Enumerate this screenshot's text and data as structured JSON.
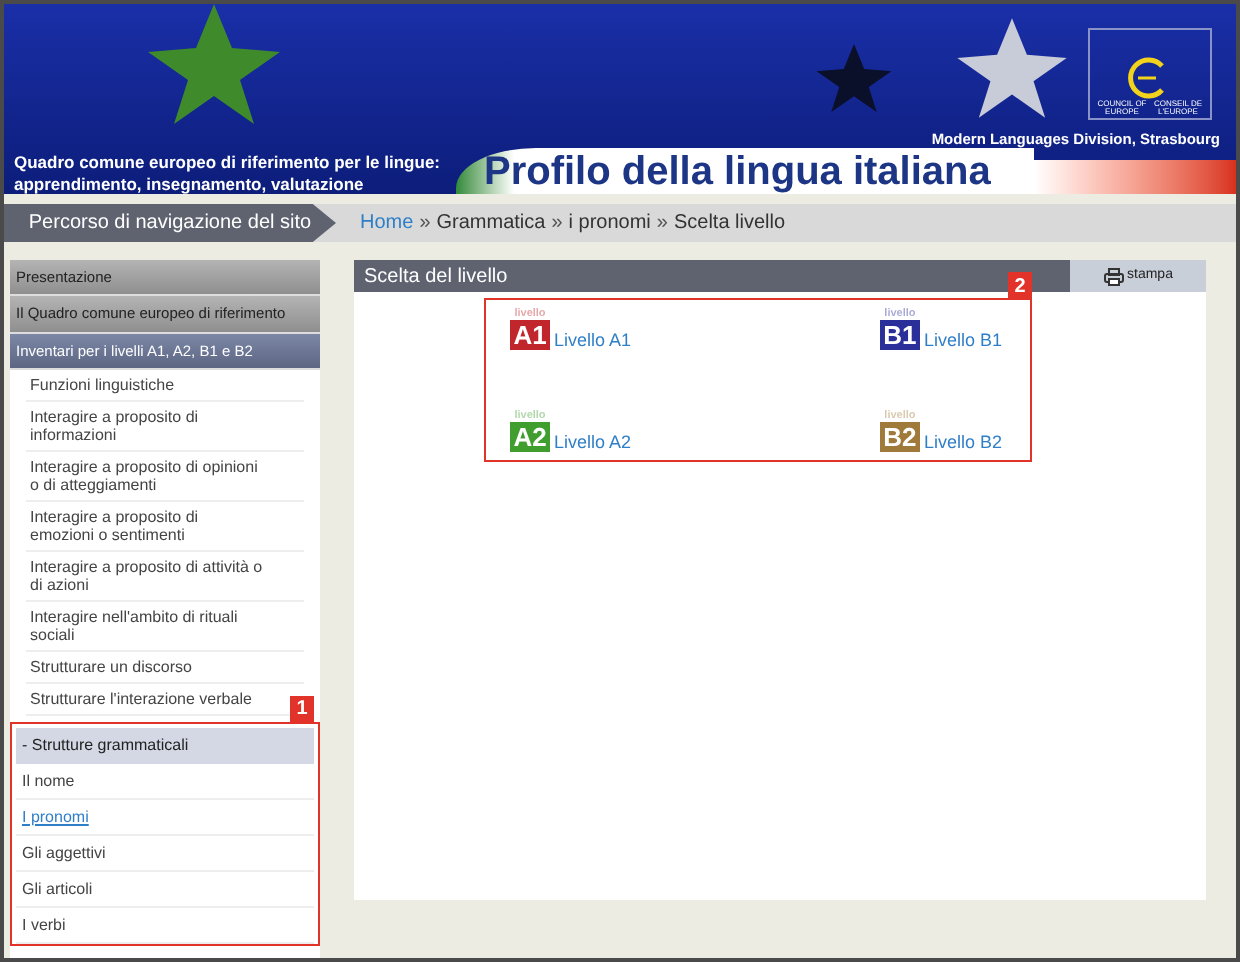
{
  "header": {
    "subtitle_lines": [
      "Quadro comune europeo di riferimento per le lingue:",
      "apprendimento, insegnamento, valutazione"
    ],
    "title": "Profilo della lingua italiana",
    "logo_texts": [
      "COUNCIL OF EUROPE",
      "CONSEIL DE L'EUROPE"
    ],
    "division": "Modern Languages Division, Strasbourg"
  },
  "nav_bar": {
    "label": "Percorso di navigazione del sito",
    "breadcrumb": [
      {
        "label": "Home",
        "link": true
      },
      {
        "label": "Grammatica",
        "link": false
      },
      {
        "label": "i pronomi",
        "link": false
      },
      {
        "label": "Scelta livello",
        "link": false
      }
    ],
    "separator": "»"
  },
  "sidebar": {
    "items": [
      {
        "label": "Presentazione",
        "kind": "section",
        "selected": false
      },
      {
        "label": "Il Quadro comune europeo di riferimento",
        "kind": "section",
        "selected": false
      },
      {
        "label": "Inventari per i livelli A1, A2, B1 e B2",
        "kind": "section",
        "selected": true
      },
      {
        "label": "Funzioni linguistiche",
        "kind": "item",
        "selected": false
      },
      {
        "label": "Interagire a proposito di informazioni",
        "kind": "item",
        "selected": false
      },
      {
        "label": "Interagire a proposito di opinioni o di atteggiamenti",
        "kind": "item",
        "selected": false
      },
      {
        "label": "Interagire a proposito di emozioni o sentimenti",
        "kind": "item",
        "selected": false
      },
      {
        "label": "Interagire a proposito di attività o di azioni",
        "kind": "item",
        "selected": false
      },
      {
        "label": "Interagire nell'ambito di rituali sociali",
        "kind": "item",
        "selected": false
      },
      {
        "label": "Strutturare un discorso",
        "kind": "item",
        "selected": false
      },
      {
        "label": "Strutturare l'interazione verbale",
        "kind": "item",
        "selected": false
      }
    ],
    "annotation": "1",
    "group": {
      "label": "- Strutture grammaticali",
      "children": [
        {
          "label": "Il nome",
          "selected": false
        },
        {
          "label": "I pronomi",
          "selected": true
        },
        {
          "label": "Gli aggettivi",
          "selected": false
        },
        {
          "label": "Gli articoli",
          "selected": false
        },
        {
          "label": "I verbi",
          "selected": false
        }
      ]
    }
  },
  "panel": {
    "title": "Scelta del livello",
    "print_button": "stampa",
    "annotation": "2",
    "levels": [
      {
        "badge_caption": "livello",
        "badge": "A1",
        "label": "Livello A1",
        "color": "#c0262c"
      },
      {
        "badge_caption": "livello",
        "badge": "B1",
        "label": "Livello B1",
        "color": "#2a2f9a"
      },
      {
        "badge_caption": "livello",
        "badge": "A2",
        "label": "Livello A2",
        "color": "#3f9e2e"
      },
      {
        "badge_caption": "livello",
        "badge": "B2",
        "label": "Livello B2",
        "color": "#a07a3a"
      }
    ]
  }
}
